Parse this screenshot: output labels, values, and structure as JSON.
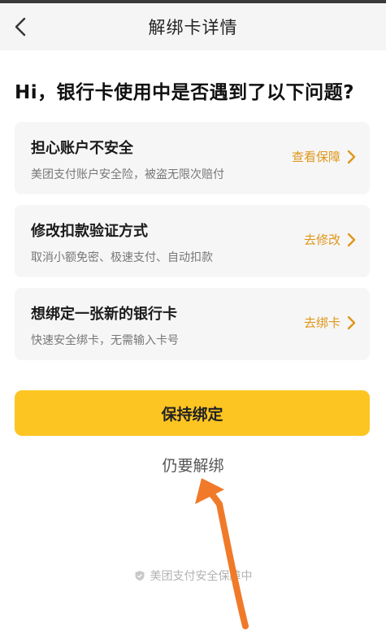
{
  "navbar": {
    "title": "解绑卡详情"
  },
  "question": "Hi，银行卡使用中是否遇到了以下问题?",
  "cards": [
    {
      "title": "担心账户不安全",
      "subtitle": "美团支付账户安全险，被盗无限次赔付",
      "action": "查看保障"
    },
    {
      "title": "修改扣款验证方式",
      "subtitle": "取消小额免密、极速支付、自动扣款",
      "action": "去修改"
    },
    {
      "title": "想绑定一张新的银行卡",
      "subtitle": "快速安全绑卡，无需输入卡号",
      "action": "去绑卡"
    }
  ],
  "primary_button": "保持绑定",
  "secondary_link": "仍要解绑",
  "footer_text": "美团支付安全保障中",
  "colors": {
    "accent": "#fcc522",
    "action_text": "#e0961a",
    "annotation_arrow": "#f07a2a"
  }
}
